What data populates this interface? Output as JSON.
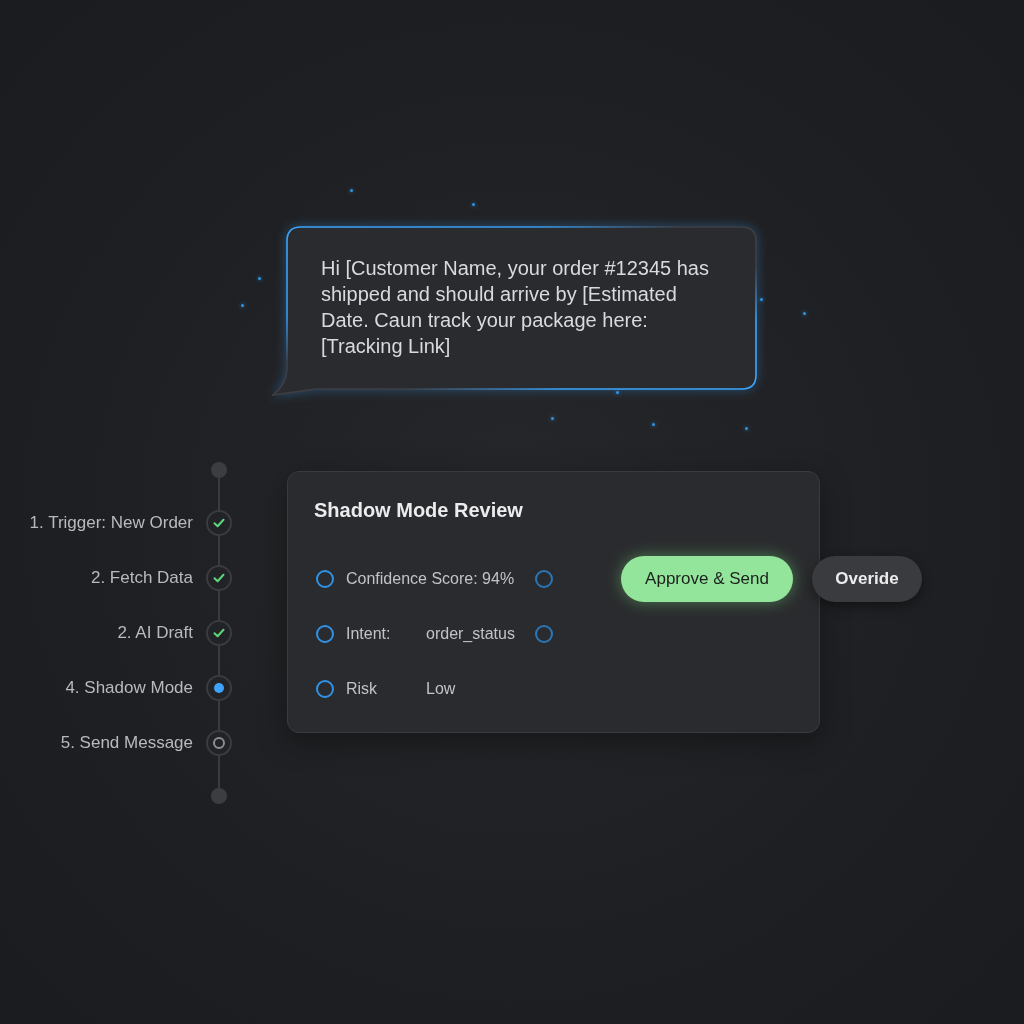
{
  "message_bubble": {
    "text": "Hi [Customer Name, your order #12345 has shipped and should arrive by [Estimated Date. Caun track your package here: [Tracking Link]"
  },
  "pipeline": {
    "steps": [
      {
        "label": "1. Trigger: New Order",
        "kind": "done"
      },
      {
        "label": "2. Fetch Data",
        "kind": "done"
      },
      {
        "label": "2. AI Draft",
        "kind": "done"
      },
      {
        "label": "4. Shadow Mode",
        "kind": "active"
      },
      {
        "label": "5. Send Message",
        "kind": "pending"
      }
    ]
  },
  "review_card": {
    "title": "Shadow Mode Review",
    "rows": [
      {
        "label": "Confidence Score: 94%",
        "end_marker": true
      },
      {
        "label": "Intent:",
        "value": "order_status",
        "end_marker": true
      },
      {
        "label": "Risk",
        "value": "Low",
        "end_marker": false
      }
    ],
    "buttons": [
      {
        "label": "Approve & Send",
        "kind": "primary"
      },
      {
        "label": "Overide",
        "kind": "secondary"
      }
    ]
  }
}
